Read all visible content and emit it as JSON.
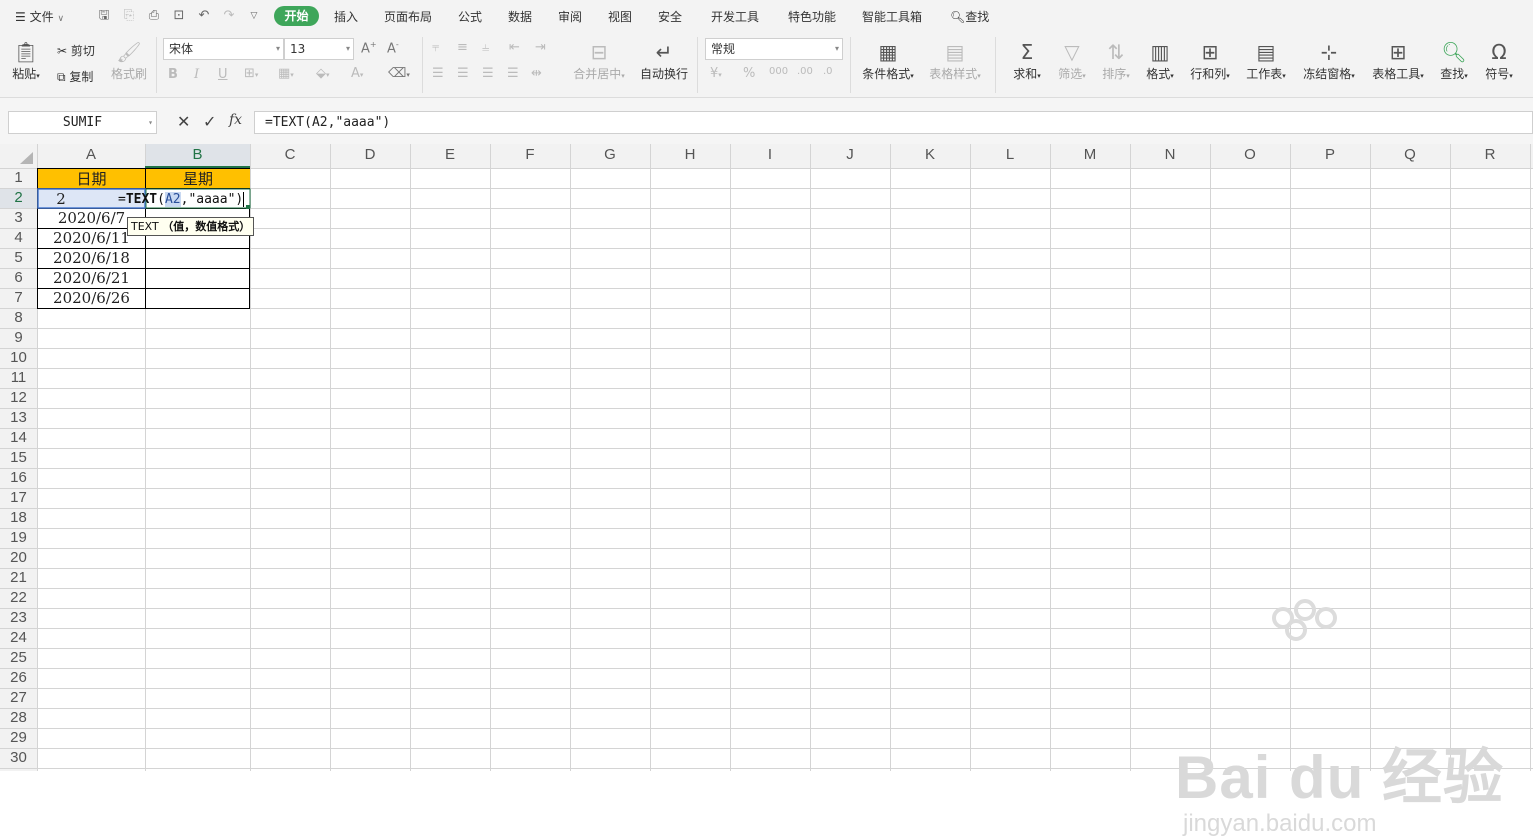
{
  "menubar": {
    "file_label": "文件",
    "tabs": [
      "开始",
      "插入",
      "页面布局",
      "公式",
      "数据",
      "审阅",
      "视图",
      "安全",
      "开发工具",
      "特色功能",
      "智能工具箱"
    ],
    "search_label": "查找"
  },
  "ribbon": {
    "paste": "粘贴",
    "cut": "剪切",
    "copy": "复制",
    "format_painter": "格式刷",
    "font_name": "宋体",
    "font_size": "13",
    "merge_center": "合并居中",
    "wrap_text": "自动换行",
    "number_format": "常规",
    "conditional_format": "条件格式",
    "table_style": "表格样式",
    "sum": "求和",
    "filter": "筛选",
    "sort": "排序",
    "format": "格式",
    "row_col": "行和列",
    "worksheet": "工作表",
    "freeze": "冻结窗格",
    "table_tools": "表格工具",
    "find": "查找",
    "symbol": "符号"
  },
  "formula_bar": {
    "name_box": "SUMIF",
    "fx": "fx",
    "formula": "=TEXT(A2,\"aaaa\")"
  },
  "sheet": {
    "columns": [
      "A",
      "B",
      "C",
      "D",
      "E",
      "F",
      "G",
      "H",
      "I",
      "J",
      "K",
      "L",
      "M",
      "N",
      "O",
      "P",
      "Q",
      "R"
    ],
    "rows": [
      "1",
      "2",
      "3",
      "4",
      "5",
      "6",
      "7",
      "8",
      "9",
      "10",
      "11",
      "12",
      "13",
      "14",
      "15",
      "16",
      "17",
      "18",
      "19",
      "20",
      "21",
      "22",
      "23",
      "24",
      "25",
      "26",
      "27",
      "28",
      "29",
      "30"
    ],
    "header_a": "日期",
    "header_b": "星期",
    "a2": "2",
    "dates": [
      "2020/6/7",
      "2020/6/11",
      "2020/6/18",
      "2020/6/21",
      "2020/6/26"
    ],
    "edit": {
      "prefix": "=",
      "func": "TEXT",
      "open": "(",
      "ref": "A2",
      "rest": ",\"aaaa\"",
      "close": ")"
    },
    "tooltip_func": "TEXT",
    "tooltip_args": "（值，数值格式）",
    "header_fill": "#ffc000"
  },
  "watermark": {
    "logo": "Bai du 经验",
    "url": "jingyan.baidu.com"
  }
}
